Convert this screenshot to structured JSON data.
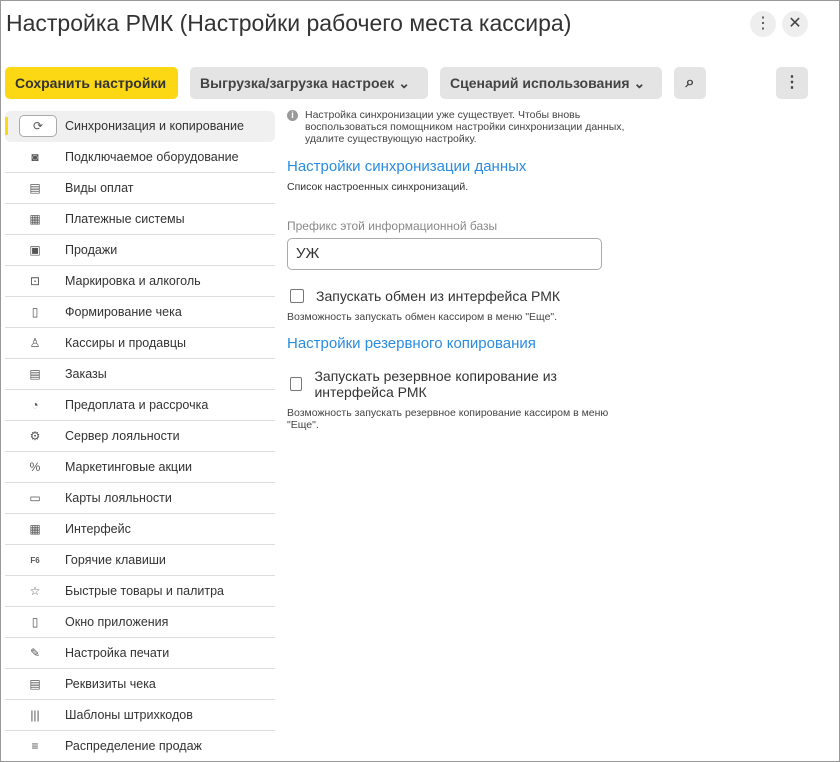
{
  "title": "Настройка РМК (Настройки рабочего места кассира)",
  "toolbar": {
    "save": "Сохранить настройки",
    "export": "Выгрузка/загрузка настроек",
    "scenario": "Сценарий использования"
  },
  "sidebar": {
    "items": [
      {
        "label": "Синхронизация и копирование",
        "icon": "⟳"
      },
      {
        "label": "Подключаемое оборудование",
        "icon": "◙"
      },
      {
        "label": "Виды оплат",
        "icon": "▤"
      },
      {
        "label": "Платежные системы",
        "icon": "▦"
      },
      {
        "label": "Продажи",
        "icon": "▣"
      },
      {
        "label": "Маркировка и алкоголь",
        "icon": "⊡"
      },
      {
        "label": "Формирование чека",
        "icon": "▯"
      },
      {
        "label": "Кассиры и продавцы",
        "icon": "♙"
      },
      {
        "label": "Заказы",
        "icon": "▤"
      },
      {
        "label": "Предоплата и рассрочка",
        "icon": "◔"
      },
      {
        "label": "Сервер лояльности",
        "icon": "⚙"
      },
      {
        "label": "Маркетинговые акции",
        "icon": "%"
      },
      {
        "label": "Карты лояльности",
        "icon": "▭"
      },
      {
        "label": "Интерфейс",
        "icon": "▦"
      },
      {
        "label": "Горячие клавиши",
        "icon": "F6"
      },
      {
        "label": "Быстрые товары и палитра",
        "icon": "☆"
      },
      {
        "label": "Окно приложения",
        "icon": "▯"
      },
      {
        "label": "Настройка печати",
        "icon": "✎"
      },
      {
        "label": "Реквизиты чека",
        "icon": "▤"
      },
      {
        "label": "Шаблоны штрихкодов",
        "icon": "|||"
      },
      {
        "label": "Распределение продаж",
        "icon": "≡"
      }
    ]
  },
  "main": {
    "info": "Настройка синхронизации уже существует. Чтобы вновь воспользоваться помощником настройки синхронизации данных, удалите существующую настройку.",
    "sync_heading": "Настройки синхронизации данных",
    "sync_sub": "Список настроенных синхронизаций.",
    "prefix_label": "Префикс этой информационной базы",
    "prefix_value": "УЖ",
    "exchange_checkbox": "Запускать обмен из интерфейса РМК",
    "exchange_note": "Возможность запускать обмен кассиром в меню \"Еще\".",
    "backup_heading": "Настройки резервного копирования",
    "backup_checkbox": "Запускать резервное копирование из интерфейса РМК",
    "backup_note": "Возможность запускать резервное копирование кассиром в меню \"Еще\"."
  }
}
